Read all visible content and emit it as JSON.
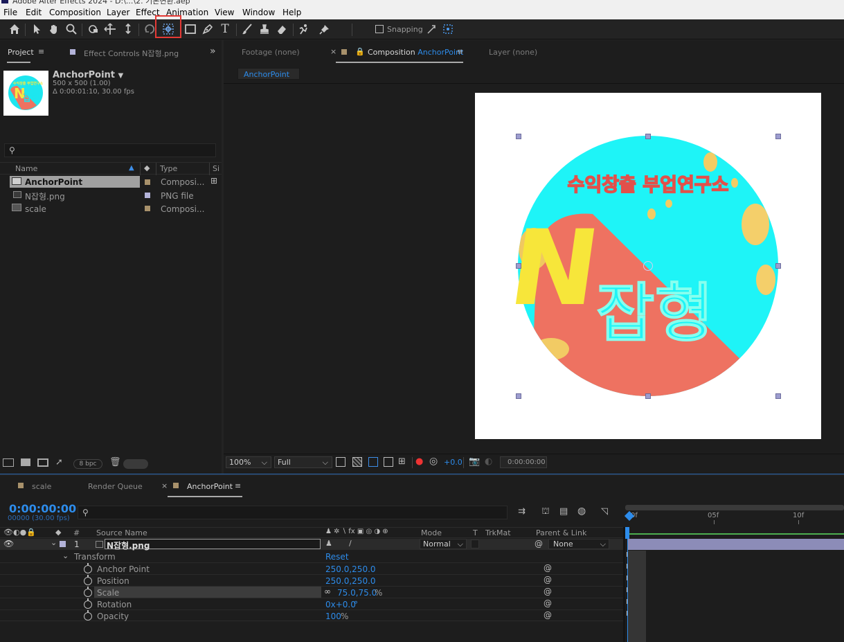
{
  "titlebar": {
    "text": "Adobe After Effects 2024 - D:\\...\\2. 기본변환.aep"
  },
  "menu": [
    "File",
    "Edit",
    "Composition",
    "Layer",
    "Effect",
    "Animation",
    "View",
    "Window",
    "Help"
  ],
  "toolbar": {
    "snapping_label": "Snapping",
    "highlight_color": "#e53935"
  },
  "project_panel": {
    "tab_project": "Project",
    "tab_effect_controls": "Effect Controls",
    "effect_controls_target": "N잡형.png",
    "item_name": "AnchorPoint",
    "item_size": "500 x 500 (1.00)",
    "item_duration": "Δ 0:00:01:10, 30.00 fps",
    "columns": {
      "name": "Name",
      "type": "Type",
      "size": "Si"
    },
    "rows": [
      {
        "name": "AnchorPoint",
        "type": "Composi...",
        "color": "#a8916b"
      },
      {
        "name": "N잡형.png",
        "type": "PNG file",
        "color": "#b3b3d9"
      },
      {
        "name": "scale",
        "type": "Composi...",
        "color": "#a8916b"
      }
    ],
    "bpc": "8 bpc"
  },
  "viewer": {
    "tab_footage": "Footage",
    "footage_value": "(none)",
    "tab_composition": "Composition",
    "composition_name": "AnchorPoint",
    "tab_layer": "Layer",
    "layer_value": "(none)",
    "breadcrumb": "AnchorPoint",
    "zoom": "100%",
    "resolution": "Full",
    "exposure": "+0.0",
    "timecode": "0:00:00:00",
    "artwork": {
      "top_text": "수익창출 부업연구소",
      "big_letter": "N",
      "big_text": "잡형"
    }
  },
  "timeline": {
    "tabs": [
      "scale",
      "Render Queue",
      "AnchorPoint"
    ],
    "timecode": "0:00:00:00",
    "frames": "00000 (30.00 fps)",
    "headers": {
      "hash": "#",
      "source_name": "Source Name",
      "mode": "Mode",
      "t": "T",
      "trkmat": "TrkMat",
      "parent": "Parent & Link"
    },
    "layer": {
      "index": "1",
      "name": "N잡형.png",
      "mode": "Normal",
      "parent": "None"
    },
    "transform_label": "Transform",
    "reset_label": "Reset",
    "properties": [
      {
        "name": "Anchor Point",
        "value": "250.0,250.0"
      },
      {
        "name": "Position",
        "value": "250.0,250.0"
      },
      {
        "name": "Scale",
        "value": "75.0,75.0",
        "unit": "%"
      },
      {
        "name": "Rotation",
        "value": "0x+0.0",
        "unit": "°"
      },
      {
        "name": "Opacity",
        "value": "100",
        "unit": "%"
      }
    ],
    "ruler": [
      "0f",
      "05f",
      "10f"
    ]
  }
}
